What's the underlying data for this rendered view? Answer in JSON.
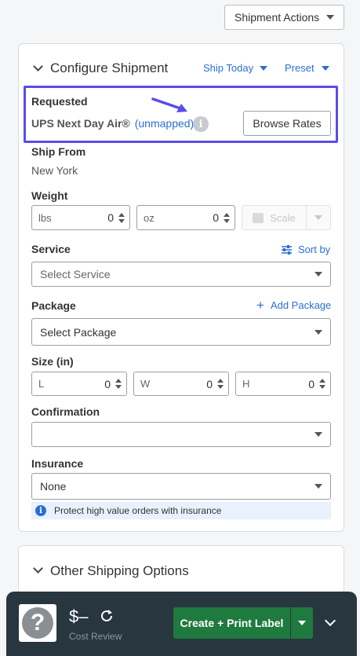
{
  "top": {
    "shipment_actions_label": "Shipment Actions"
  },
  "configure": {
    "title": "Configure Shipment",
    "ship_today": "Ship Today",
    "preset": "Preset"
  },
  "requested": {
    "label": "Requested",
    "service": "UPS Next Day Air®",
    "mapping": "(unmapped)",
    "browse_rates": "Browse Rates",
    "highlight_color": "#5b4ce8"
  },
  "ship_from": {
    "label": "Ship From",
    "value": "New York"
  },
  "weight": {
    "label": "Weight",
    "lbs_unit": "lbs",
    "lbs_value": "0",
    "oz_unit": "oz",
    "oz_value": "0",
    "scale_label": "Scale"
  },
  "service": {
    "label": "Service",
    "sort_by": "Sort by",
    "placeholder": "Select Service"
  },
  "package": {
    "label": "Package",
    "add_package": "Add Package",
    "placeholder": "Select Package"
  },
  "size": {
    "label": "Size (in)",
    "l_unit": "L",
    "l_value": "0",
    "w_unit": "W",
    "w_value": "0",
    "h_unit": "H",
    "h_value": "0"
  },
  "confirmation": {
    "label": "Confirmation",
    "value": ""
  },
  "insurance": {
    "label": "Insurance",
    "value": "None",
    "note": "Protect high value orders with insurance"
  },
  "other_options": {
    "title": "Other Shipping Options"
  },
  "footer": {
    "price": "$–",
    "cost_review": "Cost Review",
    "create_label": "Create + Print Label"
  },
  "colors": {
    "accent": "#2a6fd0",
    "primary_button": "#1f7a3f",
    "bottom_bar": "#27363f"
  }
}
